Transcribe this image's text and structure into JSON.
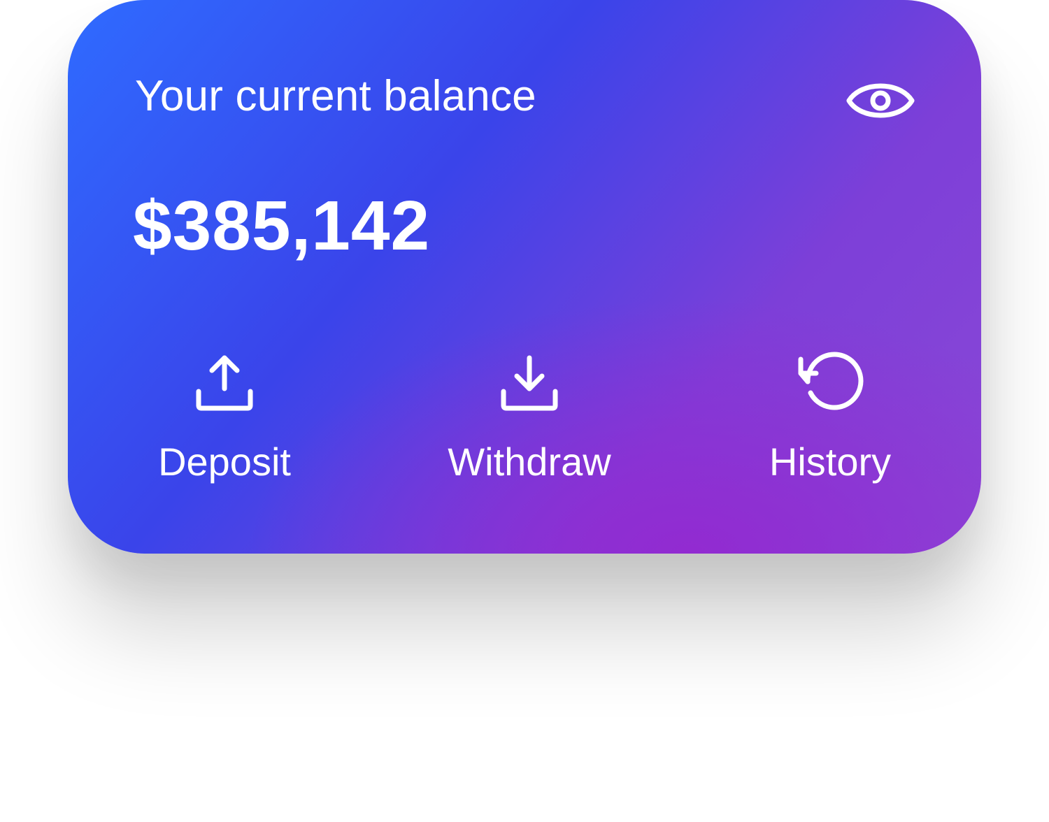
{
  "card": {
    "balance_label": "Your current balance",
    "balance_amount": "$385,142",
    "toggle_visibility_icon": "eye-icon",
    "gradient_colors": [
      "#2f6bff",
      "#3a44ea",
      "#9428d0",
      "#8a48d6"
    ]
  },
  "actions": [
    {
      "label": "Deposit",
      "icon": "upload-icon"
    },
    {
      "label": "Withdraw",
      "icon": "download-icon"
    },
    {
      "label": "History",
      "icon": "history-icon"
    }
  ]
}
